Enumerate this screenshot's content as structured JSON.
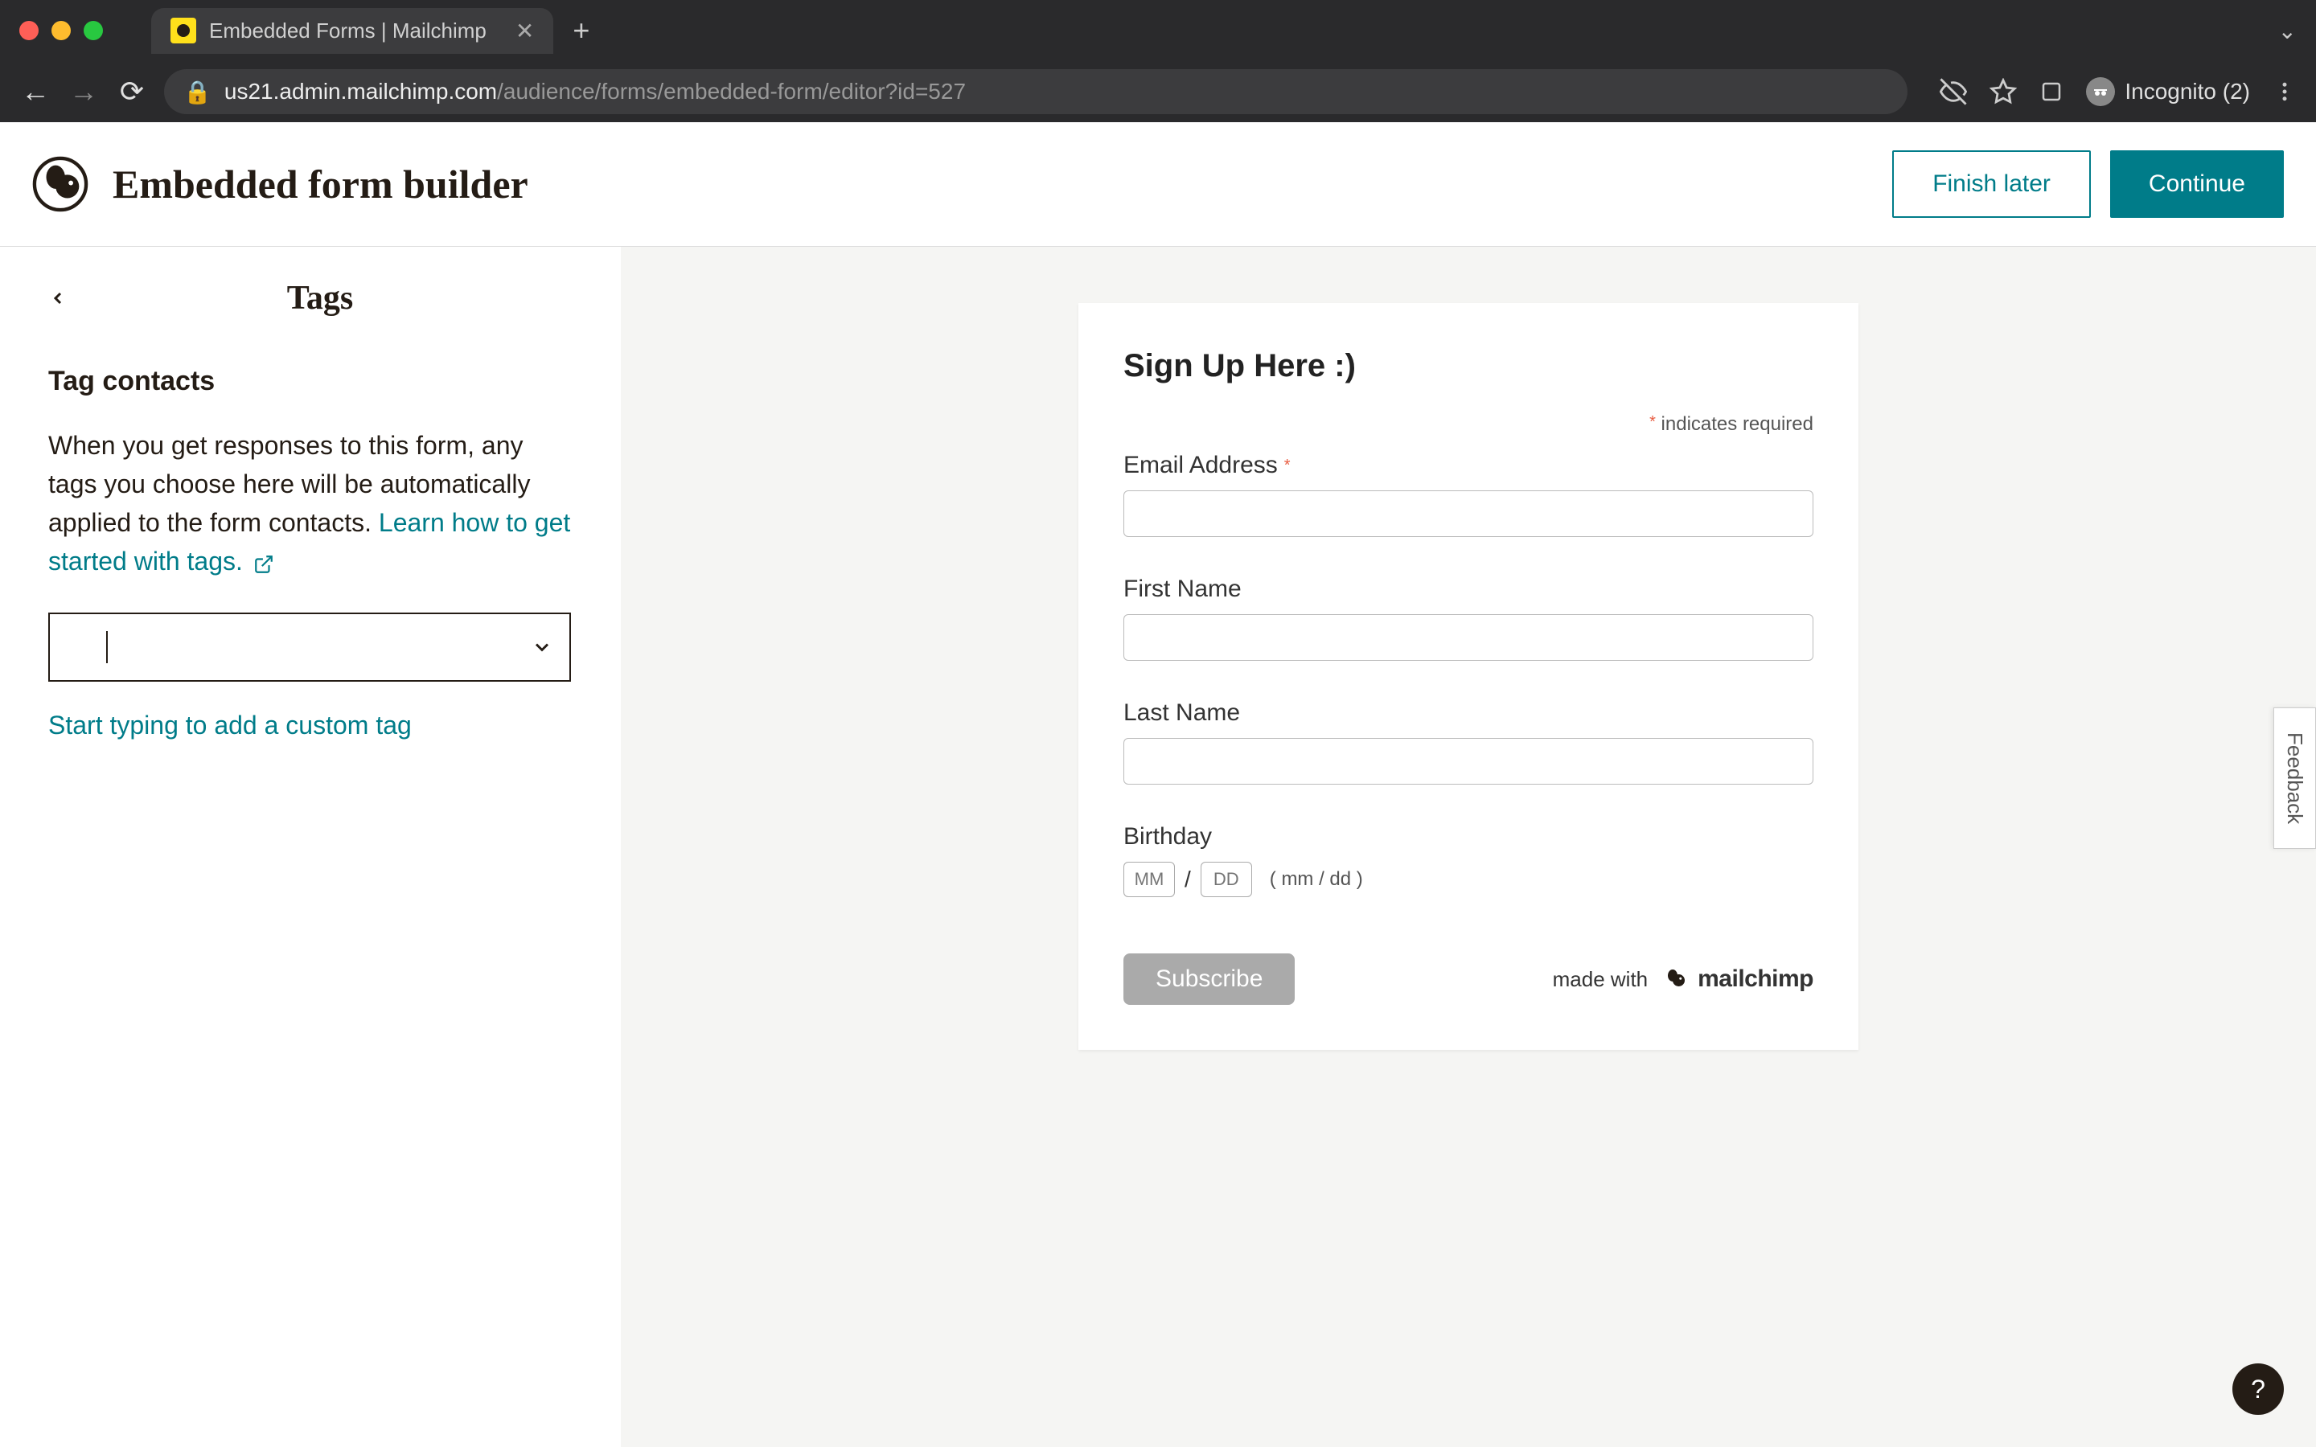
{
  "browser": {
    "tab_title": "Embedded Forms | Mailchimp",
    "url_domain": "us21.admin.mailchimp.com",
    "url_path": "/audience/forms/embedded-form/editor?id=527",
    "incognito_label": "Incognito (2)"
  },
  "header": {
    "title": "Embedded form builder",
    "finish_later": "Finish later",
    "continue": "Continue"
  },
  "sidebar": {
    "title": "Tags",
    "section_heading": "Tag contacts",
    "description": "When you get responses to this form, any tags you choose here will be automatically applied to the form contacts. ",
    "learn_link": "Learn how to get started with tags.",
    "hint": "Start typing to add a custom tag"
  },
  "form": {
    "title": "Sign Up Here :)",
    "required_note": "indicates required",
    "fields": {
      "email_label": "Email Address",
      "first_name_label": "First Name",
      "last_name_label": "Last Name",
      "birthday_label": "Birthday",
      "mm_placeholder": "MM",
      "dd_placeholder": "DD",
      "bd_hint": "( mm / dd )"
    },
    "subscribe": "Subscribe",
    "made_with": "made with",
    "brand": "mailchimp"
  },
  "misc": {
    "feedback": "Feedback",
    "help": "?"
  }
}
